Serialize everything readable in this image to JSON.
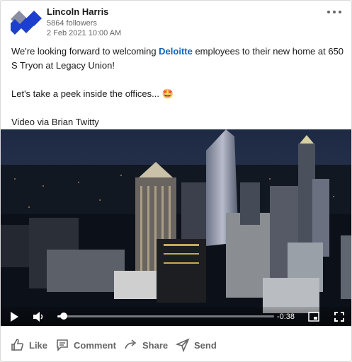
{
  "post": {
    "author": "Lincoln Harris",
    "followers": "5864 followers",
    "date": "2 Feb 2021 10:00 AM",
    "text": {
      "line1_before": "We're looking forward to welcoming ",
      "mention": "Deloitte",
      "line1_after": " employees to their new home at 650 S Tryon at Legacy Union!",
      "line2": "Let's take a peek inside the offices... 🤩",
      "line3": "Video via Brian Twitty"
    }
  },
  "video": {
    "time_remaining": "-0:38",
    "progress": 0.03
  },
  "actions": {
    "like": "Like",
    "comment": "Comment",
    "share": "Share",
    "send": "Send"
  },
  "colors": {
    "brand_blue": "#1d3fcf",
    "link_blue": "#0a66c2"
  }
}
